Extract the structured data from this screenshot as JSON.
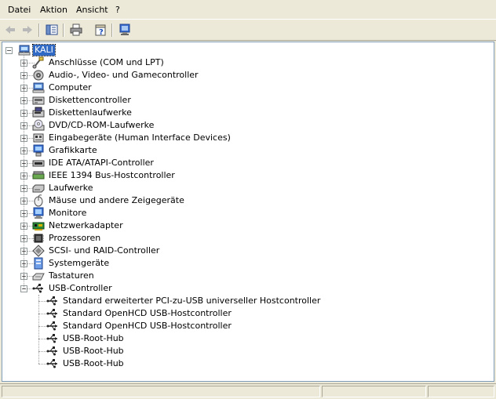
{
  "menu": {
    "items": [
      "Datei",
      "Aktion",
      "Ansicht",
      "?"
    ]
  },
  "toolbar": {
    "buttons": [
      "back-icon",
      "forward-icon",
      "show-hide-tree-icon",
      "print-icon",
      "properties-help-icon",
      "scan-hardware-icon"
    ]
  },
  "tree": {
    "root": {
      "label": "KALI",
      "icon": "computer-icon",
      "expanded": true,
      "selected": true
    },
    "categories": [
      {
        "label": "Anschlüsse (COM und LPT)",
        "icon": "port-icon",
        "expanded": false
      },
      {
        "label": "Audio-, Video- und Gamecontroller",
        "icon": "audio-icon",
        "expanded": false
      },
      {
        "label": "Computer",
        "icon": "computer-icon",
        "expanded": false
      },
      {
        "label": "Diskettencontroller",
        "icon": "floppy-controller-icon",
        "expanded": false
      },
      {
        "label": "Diskettenlaufwerke",
        "icon": "floppy-drive-icon",
        "expanded": false
      },
      {
        "label": "DVD/CD-ROM-Laufwerke",
        "icon": "cdrom-icon",
        "expanded": false
      },
      {
        "label": "Eingabegeräte (Human Interface Devices)",
        "icon": "hid-icon",
        "expanded": false
      },
      {
        "label": "Grafikkarte",
        "icon": "display-adapter-icon",
        "expanded": false
      },
      {
        "label": "IDE ATA/ATAPI-Controller",
        "icon": "ide-controller-icon",
        "expanded": false
      },
      {
        "label": "IEEE 1394 Bus-Hostcontroller",
        "icon": "ieee1394-icon",
        "expanded": false
      },
      {
        "label": "Laufwerke",
        "icon": "disk-drive-icon",
        "expanded": false
      },
      {
        "label": "Mäuse und andere Zeigegeräte",
        "icon": "mouse-icon",
        "expanded": false
      },
      {
        "label": "Monitore",
        "icon": "monitor-icon",
        "expanded": false
      },
      {
        "label": "Netzwerkadapter",
        "icon": "network-adapter-icon",
        "expanded": false
      },
      {
        "label": "Prozessoren",
        "icon": "processor-icon",
        "expanded": false
      },
      {
        "label": "SCSI- und RAID-Controller",
        "icon": "scsi-icon",
        "expanded": false
      },
      {
        "label": "Systemgeräte",
        "icon": "system-device-icon",
        "expanded": false
      },
      {
        "label": "Tastaturen",
        "icon": "keyboard-icon",
        "expanded": false
      },
      {
        "label": "USB-Controller",
        "icon": "usb-icon",
        "expanded": true,
        "children": [
          "Standard erweiterter PCI-zu-USB universeller Hostcontroller",
          "Standard OpenHCD USB-Hostcontroller",
          "Standard OpenHCD USB-Hostcontroller",
          "USB-Root-Hub",
          "USB-Root-Hub",
          "USB-Root-Hub"
        ]
      }
    ]
  },
  "colors": {
    "chrome": "#ece9d8",
    "selection": "#316ac5",
    "border": "#7f9db9"
  }
}
